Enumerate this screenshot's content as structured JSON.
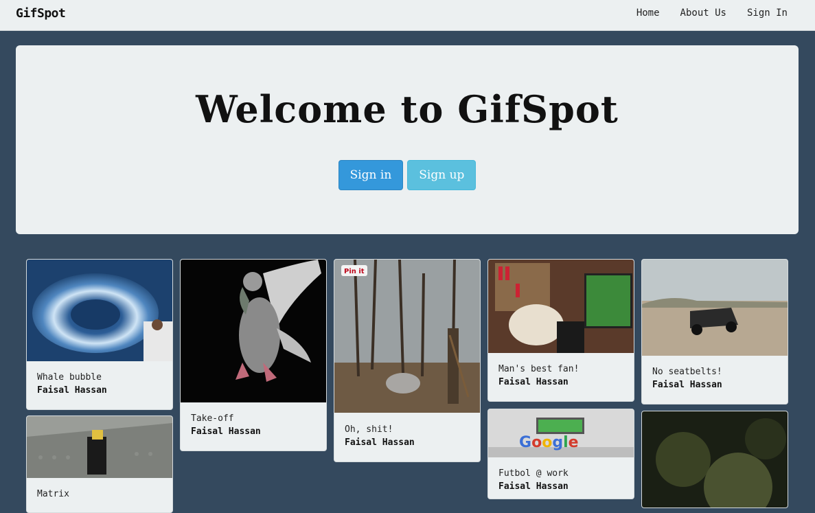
{
  "nav": {
    "brand": "GifSpot",
    "links": [
      "Home",
      "About Us",
      "Sign In"
    ]
  },
  "hero": {
    "title": "Welcome to GifSpot",
    "signin_label": "Sign in",
    "signup_label": "Sign up"
  },
  "cards": [
    {
      "title": "Whale bubble",
      "author": "Faisal Hassan"
    },
    {
      "title": "Take-off",
      "author": "Faisal Hassan"
    },
    {
      "title": "Oh, shit!",
      "author": "Faisal Hassan",
      "badge": "Pin it"
    },
    {
      "title": "Man's best fan!",
      "author": "Faisal Hassan"
    },
    {
      "title": "No seatbelts!",
      "author": "Faisal Hassan"
    },
    {
      "title": "Matrix",
      "author": ""
    },
    {
      "title": "Futbol @ work",
      "author": "Faisal Hassan"
    }
  ]
}
